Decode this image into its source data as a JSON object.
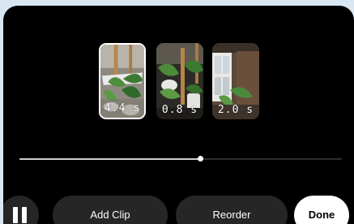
{
  "clips": [
    {
      "duration": "4.4 s",
      "selected": true
    },
    {
      "duration": "0.8 s",
      "selected": false
    },
    {
      "duration": "2.0 s",
      "selected": false
    }
  ],
  "playback": {
    "progress": 0.56
  },
  "controls": {
    "pause_icon": "pause-icon",
    "add_clip_label": "Add Clip",
    "reorder_label": "Reorder",
    "done_label": "Done"
  },
  "colors": {
    "background": "#000000",
    "button_fill": "#262626",
    "done_fill": "#ffffff",
    "selection_border": "#ffffff"
  }
}
